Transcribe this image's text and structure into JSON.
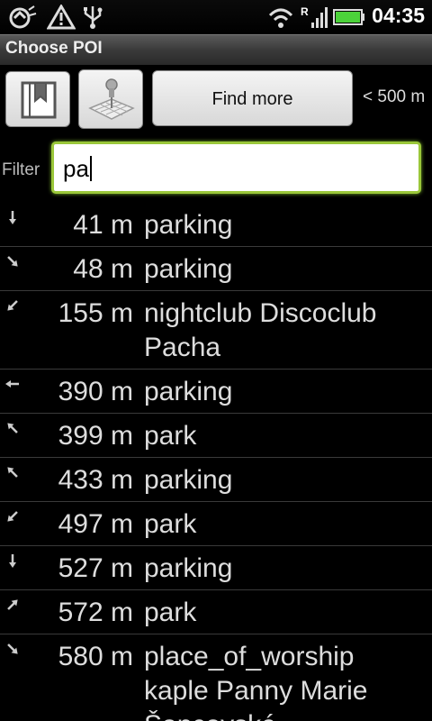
{
  "status_bar": {
    "time": "04:35",
    "icons": [
      "sync-icon",
      "warning-icon",
      "usb-icon",
      "wifi-icon",
      "roaming-signal-icon",
      "battery-icon"
    ],
    "roaming_label": "R"
  },
  "title_bar": {
    "title": "Choose POI"
  },
  "toolbar": {
    "bookmarks_icon": "bookmark-icon",
    "map_icon": "map-pin-icon",
    "find_more_label": "Find more",
    "range_label": "< 500 m"
  },
  "filter": {
    "label": "Filter",
    "value": "pa"
  },
  "list": [
    {
      "arrow": "down",
      "distance": "41 m",
      "name": "parking"
    },
    {
      "arrow": "down-right",
      "distance": "48 m",
      "name": "parking"
    },
    {
      "arrow": "down-left",
      "distance": "155 m",
      "name": "nightclub Discoclub Pacha"
    },
    {
      "arrow": "left",
      "distance": "390 m",
      "name": "parking"
    },
    {
      "arrow": "up-left",
      "distance": "399 m",
      "name": "park"
    },
    {
      "arrow": "up-left",
      "distance": "433 m",
      "name": "parking"
    },
    {
      "arrow": "down-left",
      "distance": "497 m",
      "name": "park"
    },
    {
      "arrow": "down",
      "distance": "527 m",
      "name": "parking"
    },
    {
      "arrow": "up-right",
      "distance": "572 m",
      "name": "park"
    },
    {
      "arrow": "down-right",
      "distance": "580 m",
      "name": "place_of_worship kaple Panny Marie Šancovské"
    }
  ],
  "colors": {
    "focus_border": "#9ac73a",
    "background": "#000000",
    "battery": "#4cd23a"
  }
}
